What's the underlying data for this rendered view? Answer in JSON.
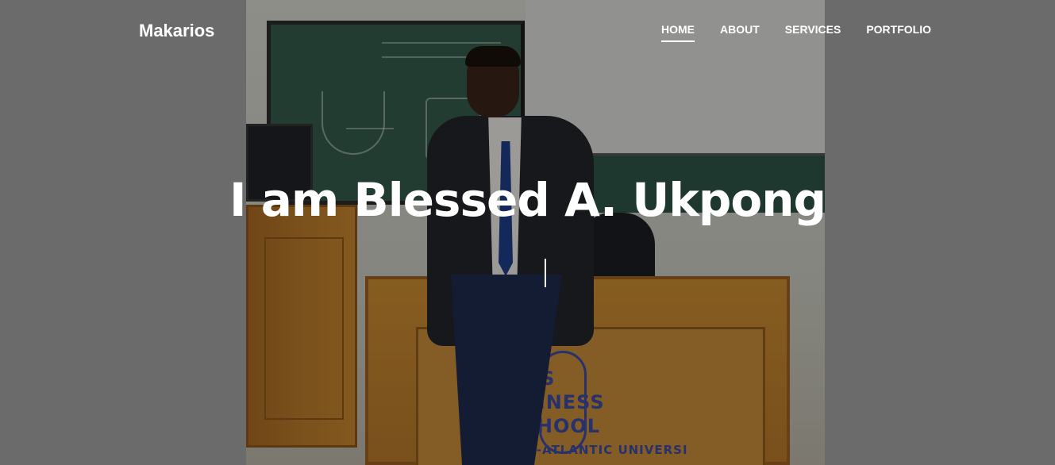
{
  "brand": {
    "name": "Makarios"
  },
  "nav": {
    "items": [
      {
        "label": "HOME",
        "active": true
      },
      {
        "label": "ABOUT",
        "active": false
      },
      {
        "label": "SERVICES",
        "active": false
      },
      {
        "label": "PORTFOLIO",
        "active": false
      }
    ]
  },
  "hero": {
    "title": "I am Blessed A. Ukpong",
    "desk_sign_lines": [
      "GOS",
      "USINESS",
      "SCHOOL",
      "PAN-ATLANTIC UNIVERSI"
    ]
  },
  "colors": {
    "page_background": "#6b6b6b",
    "text": "#ffffff"
  }
}
